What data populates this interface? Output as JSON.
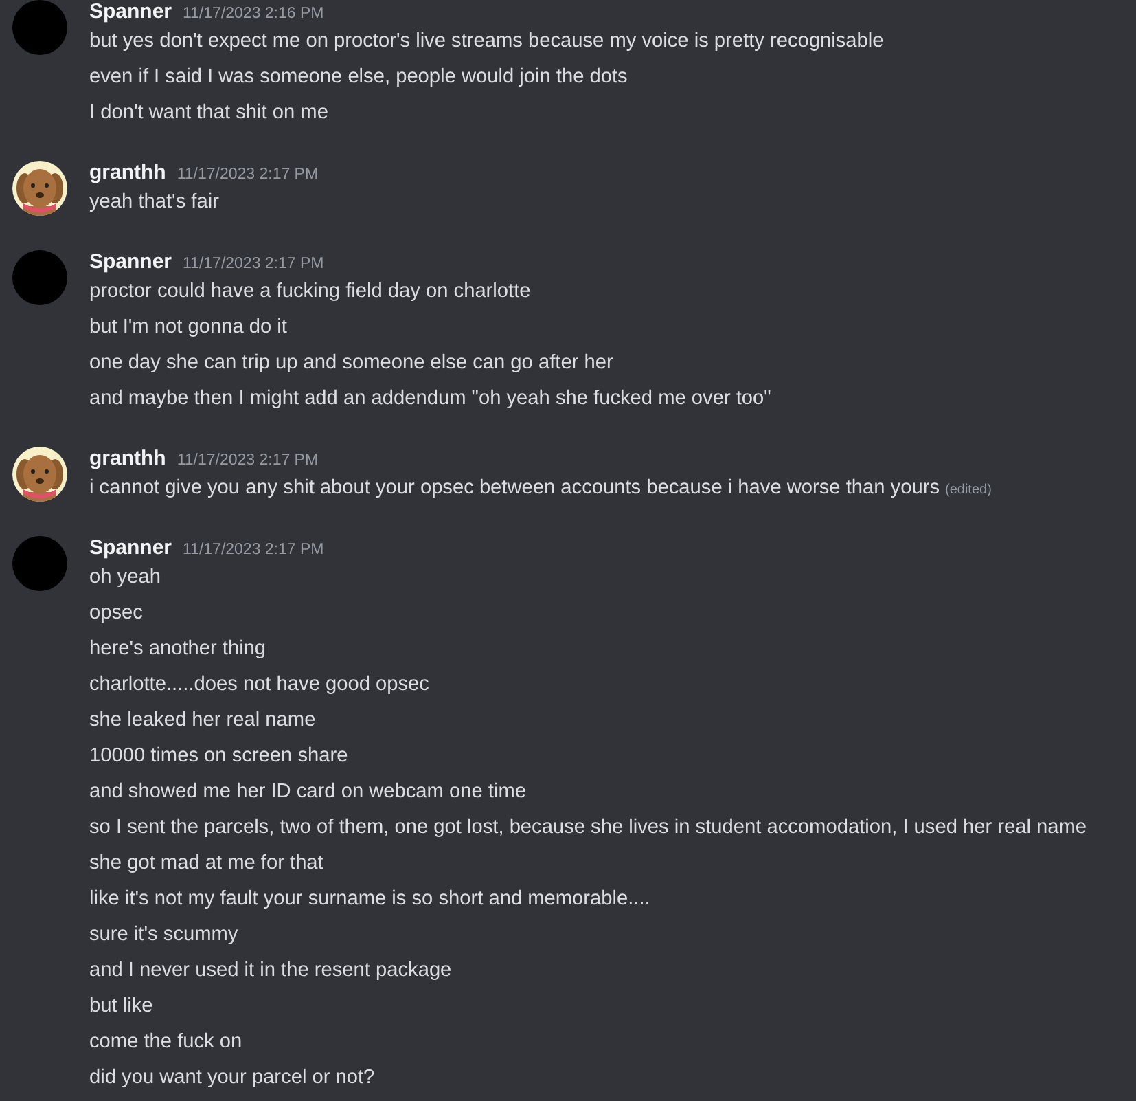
{
  "messages": [
    {
      "author": "Spanner",
      "avatar": {
        "kind": "dark"
      },
      "time": "11/17/2023 2:16 PM",
      "lines": [
        {
          "text": "but yes don't expect me on proctor's live streams because my voice is pretty recognisable"
        },
        {
          "text": "even if I said I was someone else, people would join the dots"
        },
        {
          "text": "I don't want that shit on me"
        }
      ]
    },
    {
      "author": "granthh",
      "avatar": {
        "kind": "dog"
      },
      "time": "11/17/2023 2:17 PM",
      "lines": [
        {
          "text": "yeah that's fair"
        }
      ]
    },
    {
      "author": "Spanner",
      "avatar": {
        "kind": "dark"
      },
      "time": "11/17/2023 2:17 PM",
      "lines": [
        {
          "text": "proctor could have a fucking field day on charlotte"
        },
        {
          "text": "but I'm not gonna do it"
        },
        {
          "text": "one day she can trip up and someone else can go after her"
        },
        {
          "text": "and maybe then I might add an addendum \"oh yeah she fucked me over too\""
        }
      ]
    },
    {
      "author": "granthh",
      "avatar": {
        "kind": "dog"
      },
      "time": "11/17/2023 2:17 PM",
      "lines": [
        {
          "text": "i cannot give you any shit about your opsec between accounts because i have worse than yours",
          "edited": "(edited)"
        }
      ]
    },
    {
      "author": "Spanner",
      "avatar": {
        "kind": "dark"
      },
      "time": "11/17/2023 2:17 PM",
      "lines": [
        {
          "text": "oh yeah"
        },
        {
          "text": "opsec"
        },
        {
          "text": "here's another thing"
        },
        {
          "text": "charlotte.....does not have good opsec"
        },
        {
          "text": "she leaked her real name"
        },
        {
          "text": "10000 times on screen share"
        },
        {
          "text": "and showed me her ID card on webcam one time"
        },
        {
          "text": "so I sent the parcels, two of them, one got lost, because she lives in student accomodation, I used her real name"
        },
        {
          "text": "she got mad at me for that"
        },
        {
          "text": "like it's not my fault your surname is so short and memorable...."
        },
        {
          "text": "sure it's scummy"
        },
        {
          "text": "and I never used it in the resent package"
        },
        {
          "text": "but like"
        },
        {
          "text": "come the fuck on"
        },
        {
          "text": "did you want your parcel or not?"
        }
      ]
    }
  ]
}
